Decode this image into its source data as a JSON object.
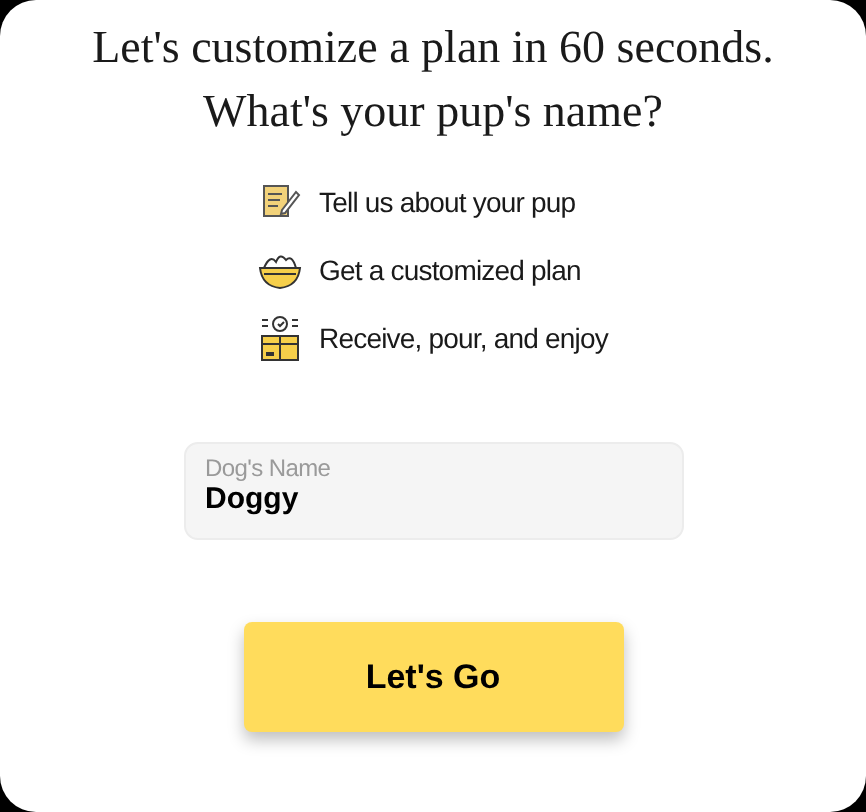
{
  "title": [
    "Let's customize a plan in 60 seconds.",
    "What's your pup's name?"
  ],
  "steps": [
    {
      "kind": "notepad",
      "text": "Tell us about your pup"
    },
    {
      "kind": "bowl",
      "text": "Get a customized plan"
    },
    {
      "kind": "box",
      "text": "Receive, pour, and enjoy"
    }
  ],
  "field": {
    "label": "Dog's Name",
    "value": "Doggy"
  },
  "button": {
    "label": "Let's Go"
  }
}
